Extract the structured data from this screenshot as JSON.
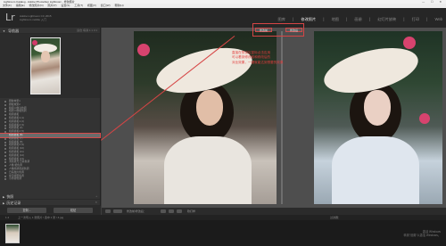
{
  "window": {
    "title": "Lightroom Catalog - Adobe Photoshop Lightroom - 修改照片",
    "controls": "— ☐ ✕"
  },
  "menubar": [
    "文件(F)",
    "编辑(E)",
    "修改照片(D)",
    "照片(P)",
    "设置(S)",
    "工具(T)",
    "视图(V)",
    "窗口(W)",
    "帮助(H)"
  ],
  "identity": {
    "logo": "Lr",
    "catalog_line1": "Adobe Lightroom CC 2015",
    "catalog_line2": "Lightroom mobile 入门"
  },
  "modules": [
    "图库",
    "修改照片",
    "地图",
    "画册",
    "幻灯片放映",
    "打印",
    "Web"
  ],
  "active_module": "修改照片",
  "left_panel": {
    "navigator_title": "导航器",
    "navigator_options": "适合 填满 1:1 3:1",
    "presets": [
      "颗粒效果1",
      "颗粒效果2",
      "暗调人像冷色调",
      "暗调人像暖色调",
      "暗调柔和",
      "暗调柔和1 (1)",
      "暗调柔和1 (2)",
      "暗调柔和2 (3)",
      "暗调柔和 (4)",
      "暗调柔和2 (5)",
      "暗调柔和 (6)",
      "暗调柔和 (7)",
      "暗调柔和 (8)",
      "暗调柔和2 (9)",
      "暗调柔和 (10)",
      "暗调柔和 (11)",
      "暗调柔和 (12)",
      "暗调柔和 (13)",
      "清新柔光 日系色调",
      "人像 暖色调",
      "人像暗调质感色调",
      "日系胶片色调",
      "夏日暖阳色调",
      "小清新色调"
    ],
    "selected_index": 10,
    "sections": [
      "快照",
      "历史记录",
      "收藏夹"
    ],
    "buttons": {
      "copy": "复制...",
      "paste": "粘贴"
    }
  },
  "view": {
    "before_label": "修改前",
    "after_label": "修改后"
  },
  "annotation": [
    "直接在预设区鼠标点击应用",
    "可以看到修改前和修改后的",
    "对比效果，一键就能达到想要的效果"
  ],
  "toolbar": {
    "view_mode_label": "修改前/修改后：",
    "soft_proof_label": "软打样"
  },
  "filmstrip": {
    "page_numbers": "1  2",
    "path": "上一次导入  1 张照片 / 选中 1 张 / 4.jpg",
    "filter_label": "过滤器："
  },
  "watermark": {
    "line1": "激活 Windows",
    "line2": "转到“设置”以激活 Windows。"
  },
  "colors": {
    "accent_red": "#d64545",
    "panel": "#333333",
    "canvas": "#4e4e4e"
  }
}
